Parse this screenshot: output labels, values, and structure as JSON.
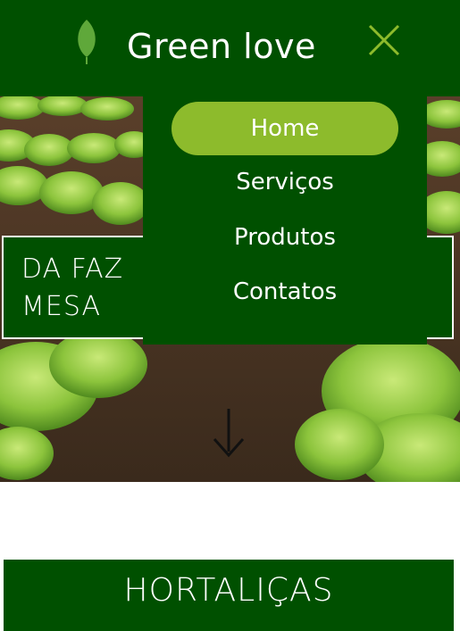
{
  "header": {
    "brand": "Green love",
    "logo_icon": "leaf-icon",
    "close_icon": "close-icon",
    "bg_color": "#005000",
    "accent_color": "#8dbb2c"
  },
  "hero": {
    "caption_line1": "DA FAZENDA À",
    "caption_line1_visible": "DA FAZ",
    "caption_line2": "MESA",
    "scroll_icon": "arrow-down-icon"
  },
  "nav": {
    "items": [
      {
        "label": "Home",
        "active": true
      },
      {
        "label": "Serviços",
        "active": false
      },
      {
        "label": "Produtos",
        "active": false
      },
      {
        "label": "Contatos",
        "active": false
      }
    ]
  },
  "section": {
    "title": "HORTALIÇAS"
  }
}
